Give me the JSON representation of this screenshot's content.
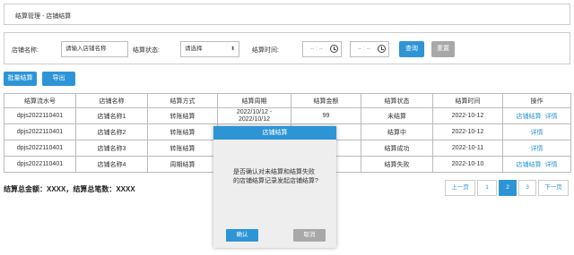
{
  "breadcrumb": {
    "parent": "结算管理",
    "separator": " - ",
    "current": "店铺结算"
  },
  "filters": {
    "store_label": "店铺名称:",
    "store_placeholder": "请输入店铺名称",
    "status_label": "结算状态:",
    "status_value": "请选择",
    "time_label": "结算时间:",
    "date_placeholder": "-- : --",
    "query_label": "查询",
    "reset_label": "重置"
  },
  "actions": {
    "batch_label": "批量结算",
    "export_label": "导出"
  },
  "table": {
    "headers": [
      "结算流水号",
      "店铺名称",
      "结算方式",
      "结算周期",
      "结算金额",
      "结算状态",
      "结算时间",
      "操作"
    ],
    "rows": [
      {
        "serial": "dpjs2022110401",
        "store": "店铺名称1",
        "method": "转账结算",
        "cycle_line1": "2022/10/12 -",
        "cycle_line2": "2022/10/12",
        "amount": "99",
        "status": "未结算",
        "time": "2022-10-12",
        "op1": "店铺结算",
        "op2": "详情"
      },
      {
        "serial": "dpjs2022110401",
        "store": "店铺名称2",
        "method": "转账结算",
        "cycle_line1": "",
        "cycle_line2": "",
        "amount": "",
        "status": "结算中",
        "time": "2022-10-12",
        "op1": "",
        "op2": "详情"
      },
      {
        "serial": "dpjs2022110401",
        "store": "店铺名称3",
        "method": "转账结算",
        "cycle_line1": "",
        "cycle_line2": "",
        "amount": "",
        "status": "结算成功",
        "time": "2022-10-11",
        "op1": "",
        "op2": "详情"
      },
      {
        "serial": "dpjs2022110401",
        "store": "店铺名称4",
        "method": "周期结算",
        "cycle_line1": "",
        "cycle_line2": "",
        "amount": "",
        "status": "结算失败",
        "time": "2022-10-10",
        "op1": "店铺结算",
        "op2": "详情"
      }
    ]
  },
  "summary": "结算总金额：XXXX，结算总笔数：XXXX",
  "pagination": {
    "prev": "上一页",
    "pages": [
      "1",
      "2",
      "3"
    ],
    "active": "2",
    "next": "下一页"
  },
  "modal": {
    "title": "店铺结算",
    "message": "是否确认对未结算和结算失败的店铺结算记录发起店铺结算?",
    "confirm_label": "确认",
    "cancel_label": "取消"
  },
  "colors": {
    "accent": "#2d95d6",
    "muted_button": "#a8a8a8",
    "modal_bg": "#eeeeee"
  },
  "icons": {
    "date_icon": "clock-icon",
    "select_icon": "chevron-down-icon"
  }
}
